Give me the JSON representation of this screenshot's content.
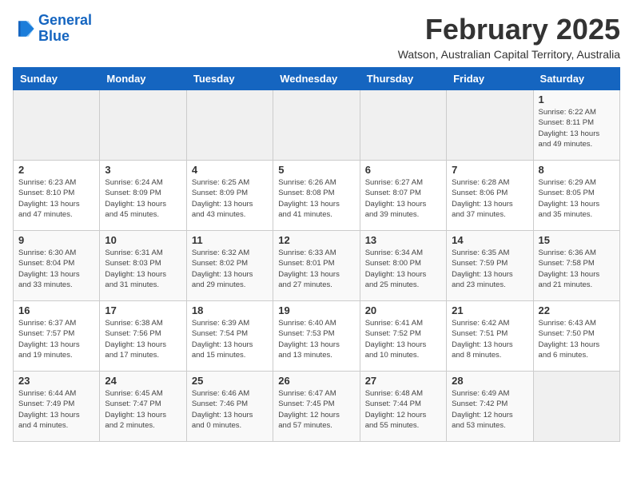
{
  "logo": {
    "line1": "General",
    "line2": "Blue"
  },
  "title": {
    "month_year": "February 2025",
    "location": "Watson, Australian Capital Territory, Australia"
  },
  "days_of_week": [
    "Sunday",
    "Monday",
    "Tuesday",
    "Wednesday",
    "Thursday",
    "Friday",
    "Saturday"
  ],
  "weeks": [
    [
      {
        "day": "",
        "info": ""
      },
      {
        "day": "",
        "info": ""
      },
      {
        "day": "",
        "info": ""
      },
      {
        "day": "",
        "info": ""
      },
      {
        "day": "",
        "info": ""
      },
      {
        "day": "",
        "info": ""
      },
      {
        "day": "1",
        "info": "Sunrise: 6:22 AM\nSunset: 8:11 PM\nDaylight: 13 hours\nand 49 minutes."
      }
    ],
    [
      {
        "day": "2",
        "info": "Sunrise: 6:23 AM\nSunset: 8:10 PM\nDaylight: 13 hours\nand 47 minutes."
      },
      {
        "day": "3",
        "info": "Sunrise: 6:24 AM\nSunset: 8:09 PM\nDaylight: 13 hours\nand 45 minutes."
      },
      {
        "day": "4",
        "info": "Sunrise: 6:25 AM\nSunset: 8:09 PM\nDaylight: 13 hours\nand 43 minutes."
      },
      {
        "day": "5",
        "info": "Sunrise: 6:26 AM\nSunset: 8:08 PM\nDaylight: 13 hours\nand 41 minutes."
      },
      {
        "day": "6",
        "info": "Sunrise: 6:27 AM\nSunset: 8:07 PM\nDaylight: 13 hours\nand 39 minutes."
      },
      {
        "day": "7",
        "info": "Sunrise: 6:28 AM\nSunset: 8:06 PM\nDaylight: 13 hours\nand 37 minutes."
      },
      {
        "day": "8",
        "info": "Sunrise: 6:29 AM\nSunset: 8:05 PM\nDaylight: 13 hours\nand 35 minutes."
      }
    ],
    [
      {
        "day": "9",
        "info": "Sunrise: 6:30 AM\nSunset: 8:04 PM\nDaylight: 13 hours\nand 33 minutes."
      },
      {
        "day": "10",
        "info": "Sunrise: 6:31 AM\nSunset: 8:03 PM\nDaylight: 13 hours\nand 31 minutes."
      },
      {
        "day": "11",
        "info": "Sunrise: 6:32 AM\nSunset: 8:02 PM\nDaylight: 13 hours\nand 29 minutes."
      },
      {
        "day": "12",
        "info": "Sunrise: 6:33 AM\nSunset: 8:01 PM\nDaylight: 13 hours\nand 27 minutes."
      },
      {
        "day": "13",
        "info": "Sunrise: 6:34 AM\nSunset: 8:00 PM\nDaylight: 13 hours\nand 25 minutes."
      },
      {
        "day": "14",
        "info": "Sunrise: 6:35 AM\nSunset: 7:59 PM\nDaylight: 13 hours\nand 23 minutes."
      },
      {
        "day": "15",
        "info": "Sunrise: 6:36 AM\nSunset: 7:58 PM\nDaylight: 13 hours\nand 21 minutes."
      }
    ],
    [
      {
        "day": "16",
        "info": "Sunrise: 6:37 AM\nSunset: 7:57 PM\nDaylight: 13 hours\nand 19 minutes."
      },
      {
        "day": "17",
        "info": "Sunrise: 6:38 AM\nSunset: 7:56 PM\nDaylight: 13 hours\nand 17 minutes."
      },
      {
        "day": "18",
        "info": "Sunrise: 6:39 AM\nSunset: 7:54 PM\nDaylight: 13 hours\nand 15 minutes."
      },
      {
        "day": "19",
        "info": "Sunrise: 6:40 AM\nSunset: 7:53 PM\nDaylight: 13 hours\nand 13 minutes."
      },
      {
        "day": "20",
        "info": "Sunrise: 6:41 AM\nSunset: 7:52 PM\nDaylight: 13 hours\nand 10 minutes."
      },
      {
        "day": "21",
        "info": "Sunrise: 6:42 AM\nSunset: 7:51 PM\nDaylight: 13 hours\nand 8 minutes."
      },
      {
        "day": "22",
        "info": "Sunrise: 6:43 AM\nSunset: 7:50 PM\nDaylight: 13 hours\nand 6 minutes."
      }
    ],
    [
      {
        "day": "23",
        "info": "Sunrise: 6:44 AM\nSunset: 7:49 PM\nDaylight: 13 hours\nand 4 minutes."
      },
      {
        "day": "24",
        "info": "Sunrise: 6:45 AM\nSunset: 7:47 PM\nDaylight: 13 hours\nand 2 minutes."
      },
      {
        "day": "25",
        "info": "Sunrise: 6:46 AM\nSunset: 7:46 PM\nDaylight: 13 hours\nand 0 minutes."
      },
      {
        "day": "26",
        "info": "Sunrise: 6:47 AM\nSunset: 7:45 PM\nDaylight: 12 hours\nand 57 minutes."
      },
      {
        "day": "27",
        "info": "Sunrise: 6:48 AM\nSunset: 7:44 PM\nDaylight: 12 hours\nand 55 minutes."
      },
      {
        "day": "28",
        "info": "Sunrise: 6:49 AM\nSunset: 7:42 PM\nDaylight: 12 hours\nand 53 minutes."
      },
      {
        "day": "",
        "info": ""
      }
    ]
  ]
}
